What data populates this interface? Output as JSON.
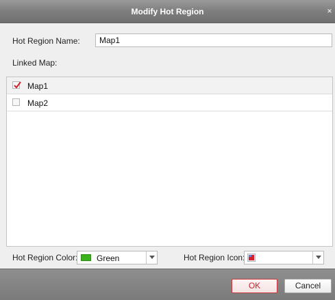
{
  "dialog": {
    "title": "Modify Hot Region",
    "close_glyph": "×"
  },
  "form": {
    "name_label": "Hot Region Name:",
    "name_value": "Map1",
    "linked_map_label": "Linked Map:"
  },
  "linked_maps": [
    {
      "label": "Map1",
      "checked": true
    },
    {
      "label": "Map2",
      "checked": false
    }
  ],
  "bottom": {
    "color_label": "Hot Region Color:",
    "color_value": "Green",
    "color_hex": "#3bb11c",
    "icon_label": "Hot Region Icon:",
    "icon_value": "red-marker-icon"
  },
  "buttons": {
    "ok": "OK",
    "cancel": "Cancel"
  },
  "colors": {
    "ok_accent": "#c8222a",
    "checkmark": "#d0202a"
  }
}
